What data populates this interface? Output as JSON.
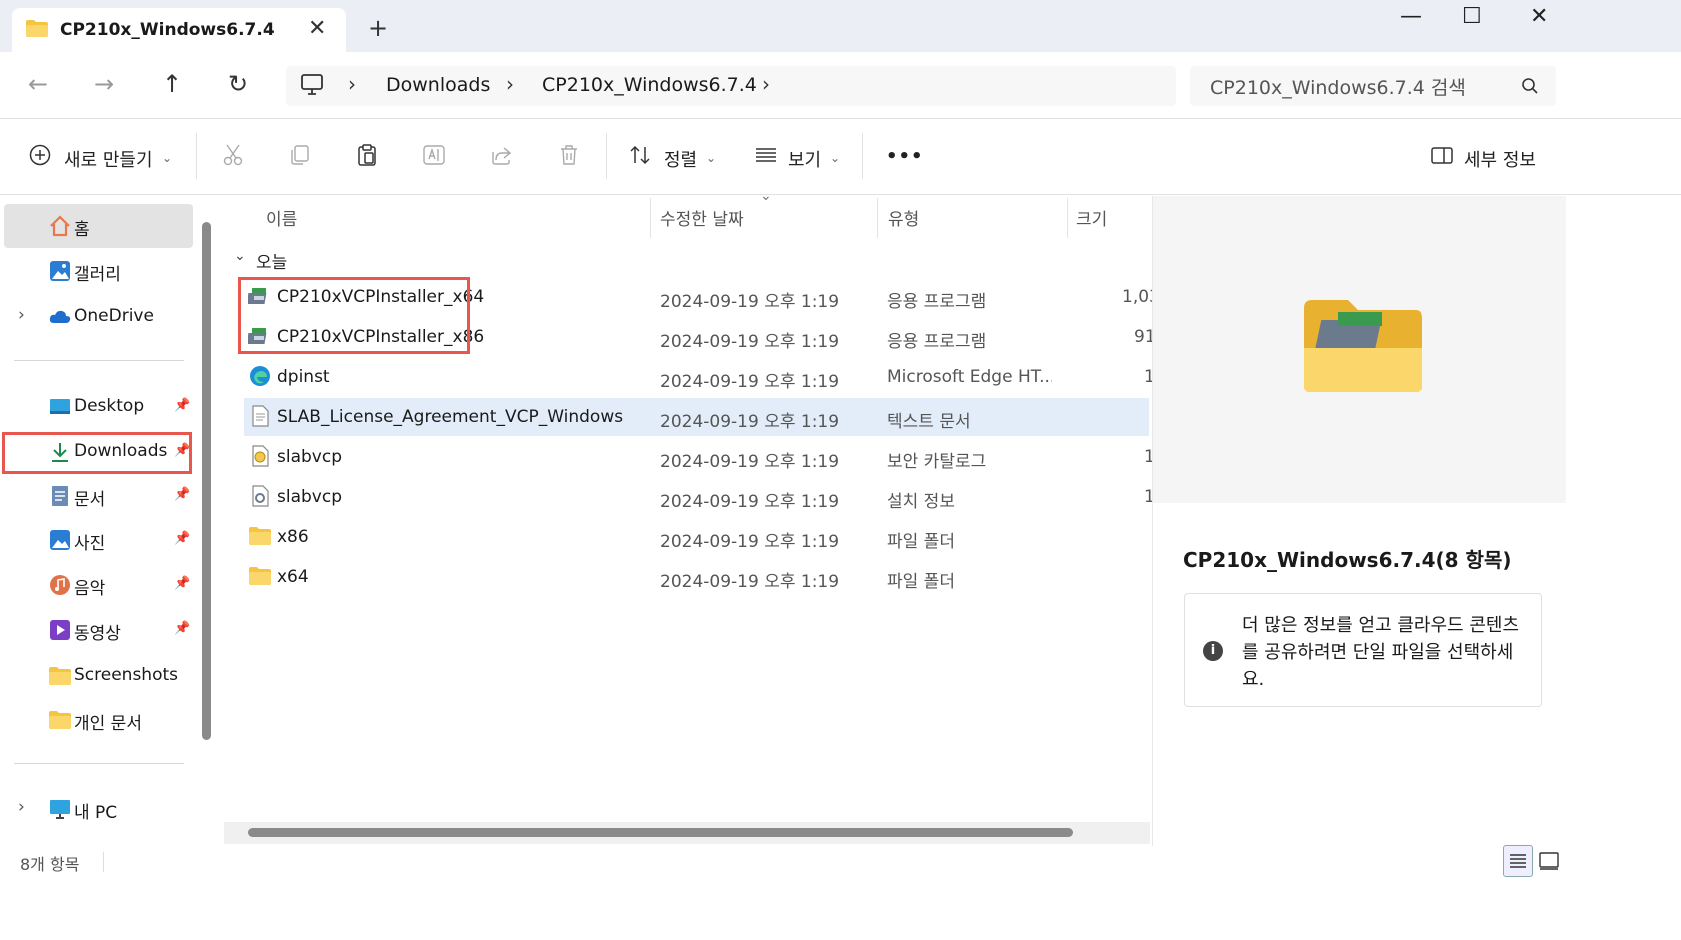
{
  "window": {
    "tab_title": "CP210x_Windows6.7.4",
    "tab_close": "✕",
    "new_tab": "+",
    "minimize": "—",
    "maximize": "☐",
    "close": "✕"
  },
  "address": {
    "breadcrumbs": [
      "Downloads",
      "CP210x_Windows6.7.4"
    ],
    "separator": "›",
    "search_placeholder": "CP210x_Windows6.7.4 검색"
  },
  "toolbar": {
    "new_label": "새로 만들기",
    "sort_label": "정렬",
    "view_label": "보기",
    "more_label": "•••",
    "details_label": "세부 정보"
  },
  "sidebar": {
    "top_items": [
      {
        "label": "홈",
        "icon": "home-icon"
      },
      {
        "label": "갤러리",
        "icon": "gallery-icon"
      },
      {
        "label": "OneDrive",
        "icon": "onedrive-icon"
      }
    ],
    "quick_access": [
      {
        "label": "Desktop",
        "icon": "desktop-icon",
        "pinned": true
      },
      {
        "label": "Downloads",
        "icon": "download-icon",
        "pinned": true
      },
      {
        "label": "문서",
        "icon": "documents-icon",
        "pinned": true
      },
      {
        "label": "사진",
        "icon": "pictures-icon",
        "pinned": true
      },
      {
        "label": "음악",
        "icon": "music-icon",
        "pinned": true
      },
      {
        "label": "동영상",
        "icon": "videos-icon",
        "pinned": true
      },
      {
        "label": "Screenshots",
        "icon": "folder-icon",
        "pinned": false
      },
      {
        "label": "개인 문서",
        "icon": "folder-icon",
        "pinned": false
      }
    ],
    "this_pc": {
      "label": "내 PC",
      "icon": "pc-icon"
    }
  },
  "file_list": {
    "columns": [
      "이름",
      "수정한 날짜",
      "유형",
      "크기"
    ],
    "group": "오늘",
    "rows": [
      {
        "name": "CP210xVCPInstaller_x64",
        "date": "2024-09-19 오후 1:19",
        "type": "응용 프로그램",
        "size": "1,03",
        "icon": "installer-icon"
      },
      {
        "name": "CP210xVCPInstaller_x86",
        "date": "2024-09-19 오후 1:19",
        "type": "응용 프로그램",
        "size": "91",
        "icon": "installer-icon"
      },
      {
        "name": "dpinst",
        "date": "2024-09-19 오후 1:19",
        "type": "Microsoft Edge HT...",
        "size": "1",
        "icon": "edge-icon"
      },
      {
        "name": "SLAB_License_Agreement_VCP_Windows",
        "date": "2024-09-19 오후 1:19",
        "type": "텍스트 문서",
        "size": "",
        "icon": "text-file-icon"
      },
      {
        "name": "slabvcp",
        "date": "2024-09-19 오후 1:19",
        "type": "보안 카탈로그",
        "size": "1",
        "icon": "catalog-icon"
      },
      {
        "name": "slabvcp",
        "date": "2024-09-19 오후 1:19",
        "type": "설치 정보",
        "size": "1",
        "icon": "setup-info-icon"
      },
      {
        "name": "x86",
        "date": "2024-09-19 오후 1:19",
        "type": "파일 폴더",
        "size": "",
        "icon": "folder-icon"
      },
      {
        "name": "x64",
        "date": "2024-09-19 오후 1:19",
        "type": "파일 폴더",
        "size": "",
        "icon": "folder-icon"
      }
    ]
  },
  "details_pane": {
    "title": "CP210x_Windows6.7.4(8 항목)",
    "info": "더 많은 정보를 얻고 클라우드 콘텐츠를 공유하려면 단일 파일을 선택하세요."
  },
  "status": {
    "item_count": "8개 항목"
  },
  "colors": {
    "highlight_border": "#e8574e",
    "selected_row": "#e2edf9",
    "folder_yellow": "#f5c542"
  }
}
